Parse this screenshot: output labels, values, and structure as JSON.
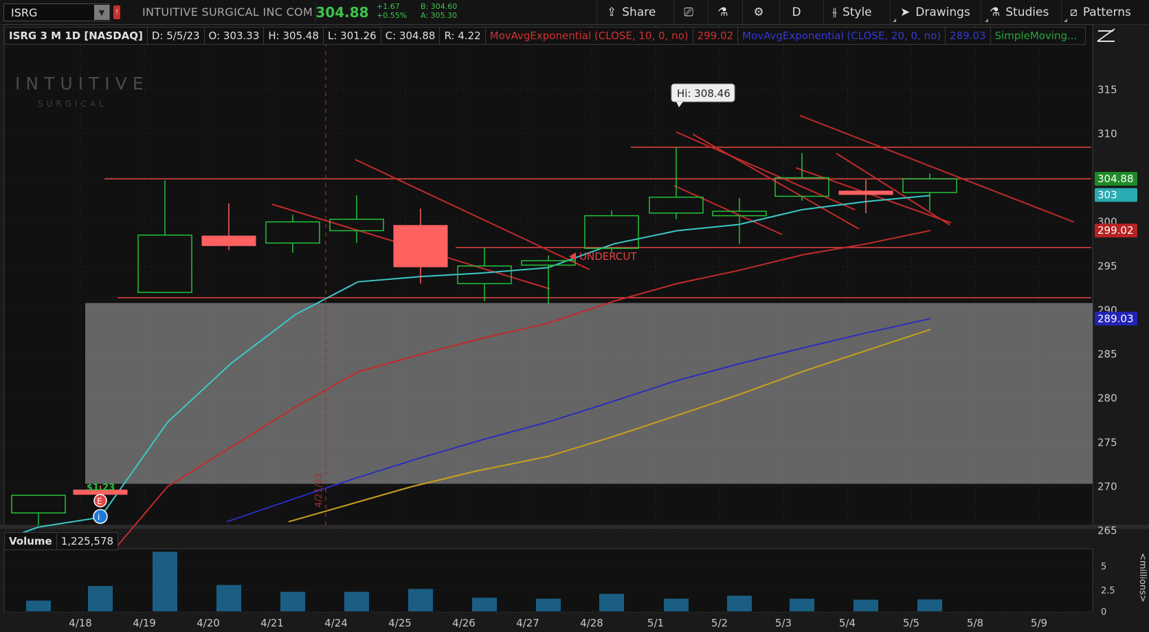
{
  "toolbar": {
    "symbol": "ISRG",
    "company": "INTUITIVE SURGICAL INC COM",
    "last": "304.88",
    "change": "+1.67",
    "change_pct": "+0.55%",
    "bid": "B: 304.60",
    "ask": "A: 305.30",
    "share_label": "Share",
    "aggregation": "D",
    "style_label": "Style",
    "drawings_label": "Drawings",
    "studies_label": "Studies",
    "patterns_label": "Patterns"
  },
  "header": {
    "title": "ISRG 3 M 1D [NASDAQ]",
    "date": "D: 5/5/23",
    "open": "O: 303.33",
    "high": "H: 305.48",
    "low": "L: 301.26",
    "close": "C: 304.88",
    "range": "R: 4.22",
    "ema10_label": "MovAvgExponential (CLOSE, 10, 0, no)",
    "ema10_value": "299.02",
    "ema20_label": "MovAvgExponential (CLOSE, 20, 0, no)",
    "ema20_value": "289.03",
    "sma_label": "SimpleMoving..."
  },
  "volume_header": {
    "label": "Volume",
    "value": "1,225,578"
  },
  "colors": {
    "up": "#24c23a",
    "down": "#ff6161",
    "ema10": "#c42b2b",
    "ema20": "#2c2cbe",
    "sma": "#c9a11c",
    "cyan": "#3cc9c9",
    "volume": "#1b5e84",
    "zone": "#6a6a6a",
    "level": "#e24545"
  },
  "annotations": {
    "hi_label": "Hi: 308.46",
    "undercut": "UNDERCUT",
    "vline_date": "4/21/23",
    "earnings_label": "$1.23",
    "watermark_line1": "INTUITIVE",
    "watermark_line2": "SURGICAL"
  },
  "badges": {
    "last": "304.88",
    "cyan": "303",
    "ema10": "299.02",
    "ema20": "289.03"
  },
  "chart_data": {
    "type": "candlestick",
    "symbol": "ISRG",
    "y_ticks": [
      265,
      270,
      275,
      280,
      285,
      290,
      295,
      300,
      305,
      310,
      315
    ],
    "ylim": [
      263.5,
      316.5
    ],
    "x_labels": [
      "4/18",
      "4/19",
      "4/20",
      "4/21",
      "4/24",
      "4/25",
      "4/26",
      "4/27",
      "4/28",
      "5/1",
      "5/2",
      "5/3",
      "5/4",
      "5/5",
      "5/8",
      "5/9"
    ],
    "candles": [
      {
        "date": "4/17",
        "o": 267,
        "h": 269,
        "l": 265.6,
        "c": 269,
        "dir": "up"
      },
      {
        "date": "4/18",
        "o": 269.6,
        "h": 270.1,
        "l": 269,
        "c": 269.1,
        "dir": "down"
      },
      {
        "date": "4/19",
        "o": 292,
        "h": 304.7,
        "l": 292,
        "c": 298.5,
        "dir": "up"
      },
      {
        "date": "4/20",
        "o": 298.4,
        "h": 302.1,
        "l": 296.8,
        "c": 297.3,
        "dir": "down"
      },
      {
        "date": "4/21",
        "o": 297.6,
        "h": 300.8,
        "l": 296.5,
        "c": 300,
        "dir": "up"
      },
      {
        "date": "4/24",
        "o": 299,
        "h": 303,
        "l": 297.6,
        "c": 300.3,
        "dir": "up"
      },
      {
        "date": "4/25",
        "o": 299.6,
        "h": 301.5,
        "l": 293,
        "c": 294.9,
        "dir": "down"
      },
      {
        "date": "4/26",
        "o": 293,
        "h": 297.1,
        "l": 291,
        "c": 295,
        "dir": "up"
      },
      {
        "date": "4/27",
        "o": 295.1,
        "h": 296.2,
        "l": 290.7,
        "c": 295.6,
        "dir": "up"
      },
      {
        "date": "4/28",
        "o": 297,
        "h": 301.3,
        "l": 296.6,
        "c": 300.7,
        "dir": "up"
      },
      {
        "date": "5/1",
        "o": 301,
        "h": 308.46,
        "l": 300.3,
        "c": 302.8,
        "dir": "up"
      },
      {
        "date": "5/2",
        "o": 300.7,
        "h": 302.7,
        "l": 297.5,
        "c": 301.2,
        "dir": "up"
      },
      {
        "date": "5/3",
        "o": 302.9,
        "h": 307.8,
        "l": 302.4,
        "c": 305,
        "dir": "up"
      },
      {
        "date": "5/4",
        "o": 303.5,
        "h": 304.8,
        "l": 301,
        "c": 303.1,
        "dir": "down"
      },
      {
        "date": "5/5",
        "o": 303.33,
        "h": 305.48,
        "l": 301.26,
        "c": 304.88,
        "dir": "up"
      }
    ],
    "series": [
      {
        "name": "MovAvgExponential (CLOSE, 10, 0, no)",
        "color": "#c42b2b",
        "values": [
          263,
          270,
          274.5,
          279,
          283,
          285,
          286.8,
          288.5,
          291,
          293,
          294.5,
          296.3,
          297.5,
          299.02
        ]
      },
      {
        "name": "MovAvgExponential (CLOSE, 20, 0, no)",
        "color": "#2c2cbe",
        "values": [
          263.5,
          266,
          268.5,
          270.9,
          273.2,
          275.3,
          277.3,
          279.6,
          281.9,
          283.9,
          285.7,
          287.4,
          289.03
        ]
      },
      {
        "name": "SimpleMoving...",
        "color": "#c9a11c",
        "values": [
          264,
          266,
          268,
          270,
          271.7,
          273.4,
          275.6,
          278,
          280.4,
          283,
          285.4,
          287.8
        ]
      },
      {
        "name": "",
        "color": "#3cc9c9",
        "values": [
          264,
          265.4,
          266.5,
          277.3,
          284,
          289.5,
          293.2,
          293.8,
          294.2,
          294.8,
          297.5,
          299,
          299.7,
          301.4,
          302.3,
          303
        ]
      }
    ],
    "horizontal_levels": [
      308.46,
      304.88,
      297.1,
      291.4
    ],
    "zone": [
      270.3,
      290.8
    ],
    "volume": {
      "unit": "millions",
      "y_ticks": [
        "0",
        "2.5",
        "5"
      ],
      "values": [
        1.1,
        2.6,
        6.1,
        2.7,
        2.0,
        2.0,
        2.3,
        1.4,
        1.3,
        1.8,
        1.3,
        1.6,
        1.3,
        1.2,
        1.226
      ]
    }
  }
}
